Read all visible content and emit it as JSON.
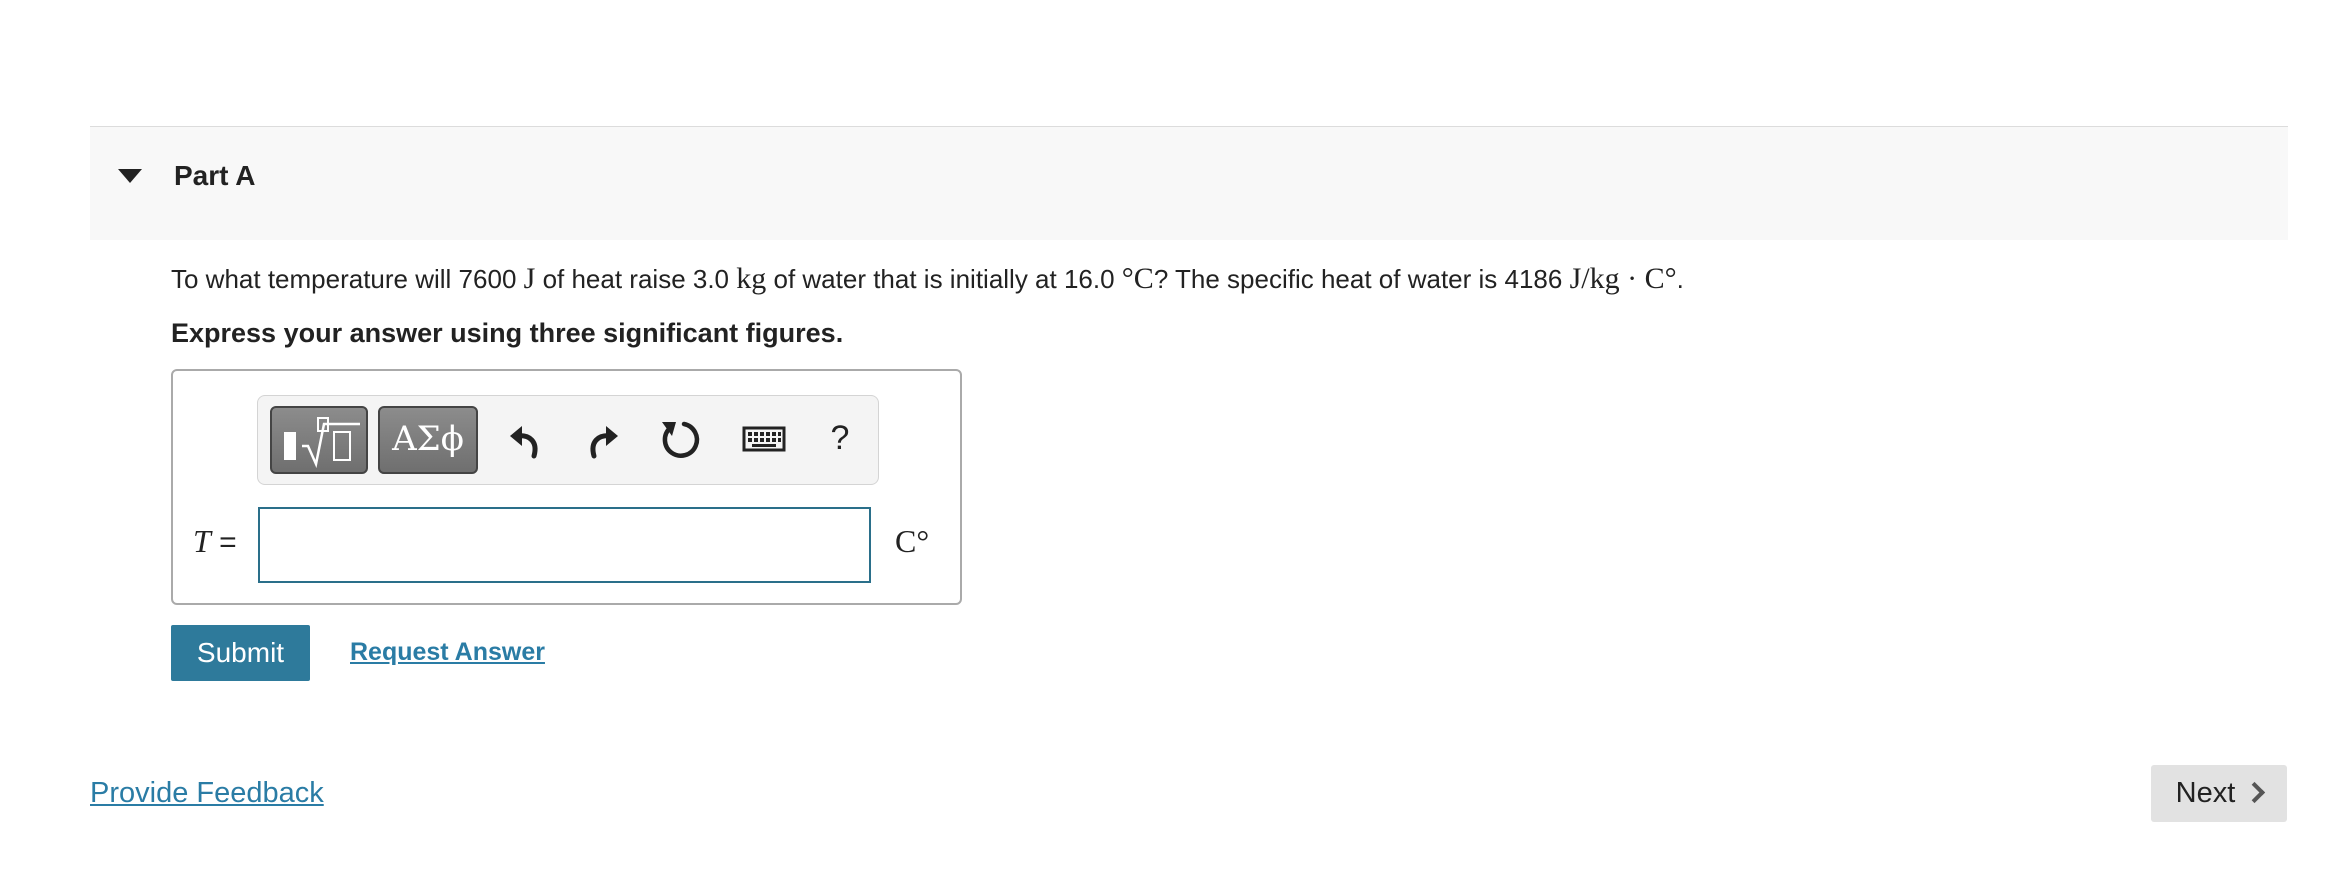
{
  "part": {
    "title": "Part A"
  },
  "question": {
    "text_1": "To what temperature will 7600",
    "unit_1": "J",
    "text_2": "of heat raise 3.0",
    "unit_2": "kg",
    "text_3": "of water that is initially at 16.0",
    "unit_3": "°C",
    "text_4": "? The specific heat of water is 4186",
    "unit_4": "J/kg · C°",
    "text_5": "."
  },
  "instruction": "Express your answer using three significant figures.",
  "toolbar": {
    "symbols_label": "ΑΣϕ",
    "help_label": "?"
  },
  "answer": {
    "variable": "T",
    "equals": "=",
    "value": "",
    "unit": "C°"
  },
  "actions": {
    "submit_label": "Submit",
    "request_answer_label": "Request Answer"
  },
  "footer": {
    "feedback_label": "Provide Feedback",
    "next_label": "Next"
  }
}
